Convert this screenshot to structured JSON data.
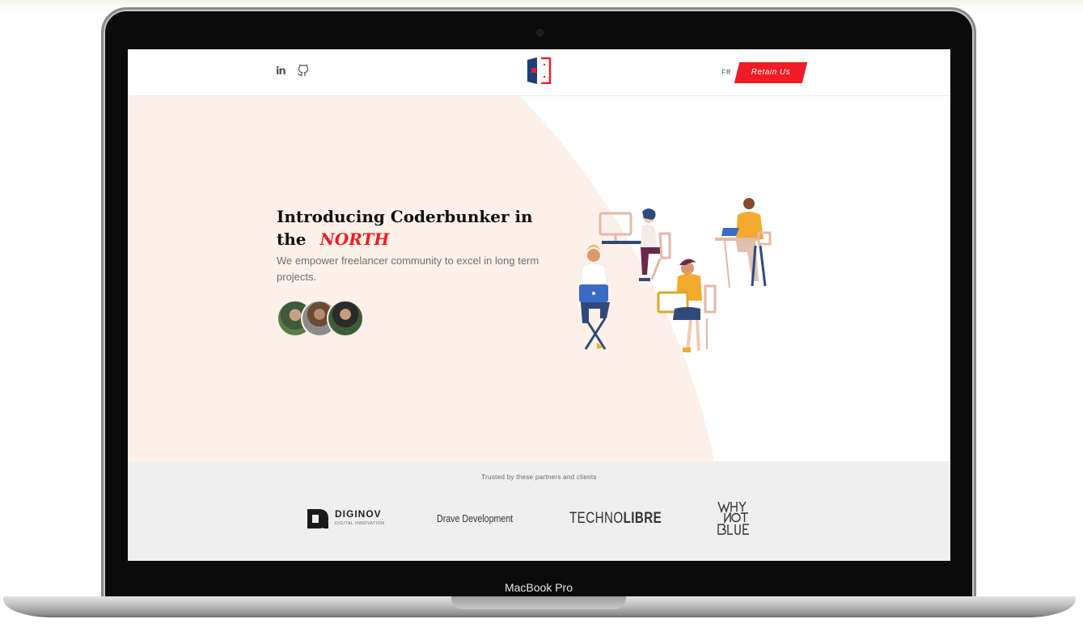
{
  "device": {
    "label": "MacBook Pro"
  },
  "nav": {
    "social": [
      {
        "name": "linkedin",
        "icon": "linkedin-icon",
        "glyph": "in"
      },
      {
        "name": "github",
        "icon": "github-icon",
        "glyph": "⚲"
      }
    ],
    "logo_icon": "coderbunker-logo-icon",
    "language": "FR",
    "cta_label": "Retain Us"
  },
  "hero": {
    "headline_prefix": "Introducing Coderbunker in the",
    "headline_highlight": "NORTH",
    "subtitle": "We empower freelancer community to excel in long term projects.",
    "avatars": [
      "team-member-1",
      "team-member-2",
      "team-member-3"
    ],
    "illustration": "people-working-on-laptops-illustration"
  },
  "partners": {
    "heading": "Trusted by these partners and clients",
    "items": [
      {
        "name": "DIGINOV",
        "tagline": "DIGITAL INNOVATION"
      },
      {
        "name": "Drave Development"
      },
      {
        "name_light": "TECHNO",
        "name_bold": "LIBRE"
      },
      {
        "name": "WHY NOT BLUE"
      }
    ]
  },
  "colors": {
    "accent": "#ee1c25",
    "hero_bg": "#fdf0e8",
    "partners_bg": "#efefef",
    "logo_blue": "#1f3f7a"
  }
}
